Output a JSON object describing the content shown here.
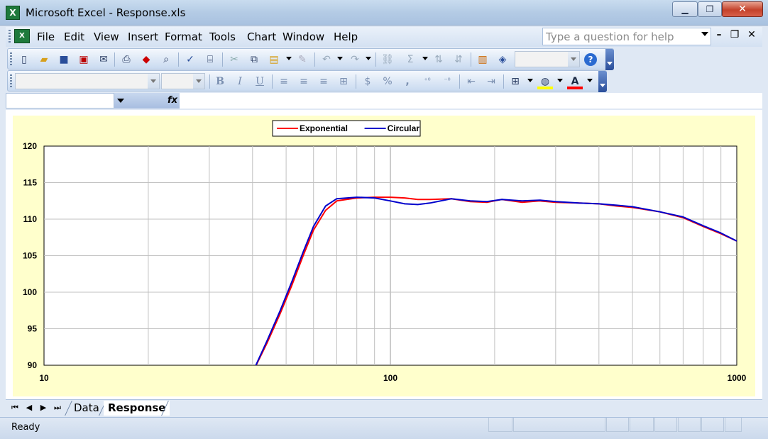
{
  "window": {
    "title": "Microsoft Excel - Response.xls",
    "minimize_glyph": "▁",
    "restore_glyph": "❐",
    "close_glyph": "✕"
  },
  "menu": {
    "items": [
      "File",
      "Edit",
      "View",
      "Insert",
      "Format",
      "Tools",
      "Chart",
      "Window",
      "Help"
    ],
    "help_placeholder": "Type a question for help",
    "doc_minimize": "–",
    "doc_restore": "❐",
    "doc_close": "✕"
  },
  "format_toolbar": {
    "bold": "B",
    "italic": "I",
    "underline": "U",
    "currency": "$",
    "percent": "%",
    "comma": ","
  },
  "formula_bar": {
    "fx_label": "fx"
  },
  "chart_data": {
    "type": "line",
    "x_scale": "log",
    "xlim": [
      10,
      1000
    ],
    "ylim": [
      90,
      120
    ],
    "y_ticks": [
      "120",
      "115",
      "110",
      "105",
      "100",
      "95",
      "90"
    ],
    "x_ticks": [
      "10",
      "100",
      "1000"
    ],
    "grid": true,
    "legend_placement": "top-center",
    "series": [
      {
        "name": "Exponential",
        "color": "#ff0000",
        "x": [
          40,
          44,
          48,
          52,
          56,
          60,
          65,
          70,
          80,
          90,
          100,
          110,
          120,
          130,
          150,
          170,
          190,
          210,
          240,
          270,
          300,
          350,
          400,
          450,
          500,
          600,
          700,
          800,
          900,
          1000
        ],
        "y": [
          89.0,
          93.0,
          97.0,
          101.0,
          105.0,
          108.5,
          111.2,
          112.5,
          112.9,
          113.0,
          113.0,
          112.9,
          112.7,
          112.7,
          112.8,
          112.4,
          112.3,
          112.7,
          112.3,
          112.5,
          112.3,
          112.2,
          112.1,
          111.8,
          111.6,
          111.0,
          110.2,
          109.0,
          108.0,
          107.0
        ]
      },
      {
        "name": "Circular",
        "color": "#0000cc",
        "x": [
          40,
          44,
          48,
          52,
          56,
          60,
          65,
          70,
          80,
          90,
          100,
          110,
          120,
          130,
          150,
          170,
          190,
          210,
          240,
          270,
          300,
          350,
          400,
          450,
          500,
          600,
          700,
          800,
          900,
          1000
        ],
        "y": [
          89.0,
          93.3,
          97.4,
          101.5,
          105.5,
          109.0,
          111.8,
          112.8,
          113.0,
          112.9,
          112.5,
          112.1,
          112.0,
          112.2,
          112.8,
          112.5,
          112.4,
          112.7,
          112.5,
          112.6,
          112.4,
          112.2,
          112.1,
          111.9,
          111.7,
          111.0,
          110.3,
          109.1,
          108.1,
          107.0
        ]
      }
    ]
  },
  "sheets": {
    "tabs": [
      "Data",
      "Response"
    ],
    "active": "Response"
  },
  "status": {
    "text": "Ready"
  }
}
